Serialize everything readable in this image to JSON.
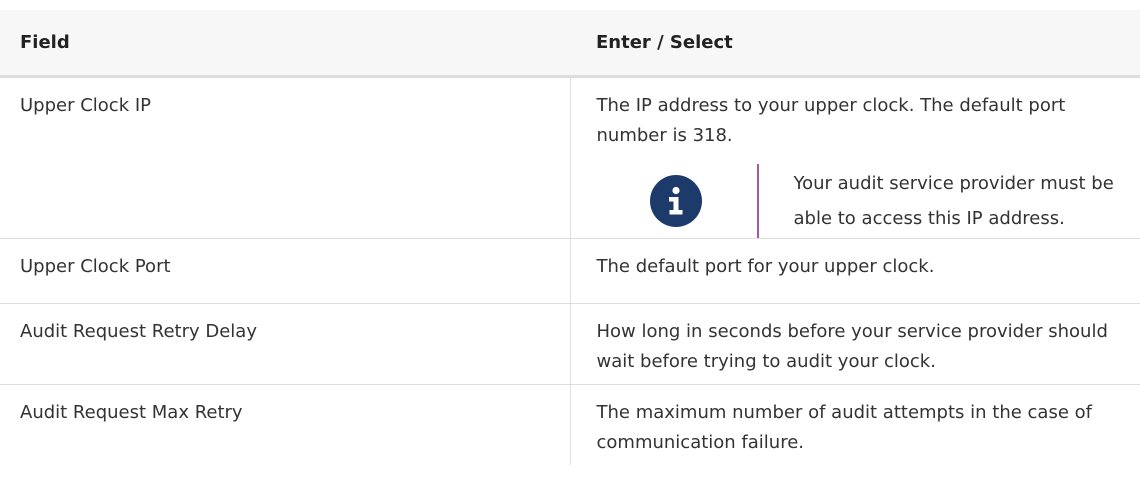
{
  "table": {
    "header": {
      "field": "Field",
      "enter_select": "Enter / Select"
    },
    "rows": [
      {
        "field": "Upper Clock IP",
        "description": "The IP address to your upper clock. The default port number is 318.",
        "note": {
          "icon": "info-icon",
          "text": "Your audit service provider must be able to access this IP address."
        }
      },
      {
        "field": "Upper Clock Port",
        "description": "The default port for your upper clock."
      },
      {
        "field": "Audit Request Retry Delay",
        "description": "How long in seconds before your service provider should wait before trying to audit your clock."
      },
      {
        "field": "Audit Request Max Retry",
        "description": "The maximum number of audit attempts in the case of communication failure."
      }
    ]
  },
  "colors": {
    "header_bg": "#f7f7f7",
    "border": "#dddddd",
    "note_icon_bg": "#1d3b6a",
    "note_bar": "#a05aa8",
    "text": "#333333"
  }
}
